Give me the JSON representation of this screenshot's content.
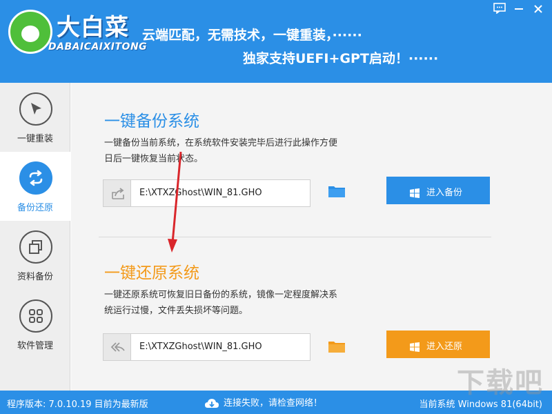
{
  "header": {
    "logo_title": "大白菜",
    "logo_subtitle": "DABAICAIXITONG",
    "slogan_line1": "云端匹配，无需技术，一键重装，······",
    "slogan_line2": "独家支持UEFI+GPT启动！······"
  },
  "window_controls": [
    "feedback-icon",
    "minimize-icon",
    "close-icon"
  ],
  "sidebar": {
    "items": [
      {
        "label": "一键重装",
        "icon": "cursor-icon"
      },
      {
        "label": "备份还原",
        "icon": "sync-icon"
      },
      {
        "label": "资料备份",
        "icon": "copy-icon"
      },
      {
        "label": "软件管理",
        "icon": "grid-icon"
      }
    ],
    "active_index": 1
  },
  "backup": {
    "title": "一键备份系统",
    "description": "一键备份当前系统，在系统软件安装完毕后进行此操作方便日后一键恢复当前状态。",
    "path": "E:\\XTXZGhost\\WIN_81.GHO",
    "button_label": "进入备份"
  },
  "restore": {
    "title": "一键还原系统",
    "description": "一键还原系统可恢复旧日备份的系统，镜像一定程度解决系统运行过慢，文件丢失损坏等问题。",
    "path": "E:\\XTXZGhost\\WIN_81.GHO",
    "button_label": "进入还原"
  },
  "statusbar": {
    "version": "程序版本: 7.0.10.19 目前为最新版",
    "network": "连接失败，请检查网络！",
    "system": "当前系统 Windows 81(64bit)"
  },
  "watermark": "下载吧",
  "colors": {
    "primary": "#2b8fe6",
    "accent_orange": "#f39a1a",
    "annotation_arrow": "#d9262b"
  }
}
